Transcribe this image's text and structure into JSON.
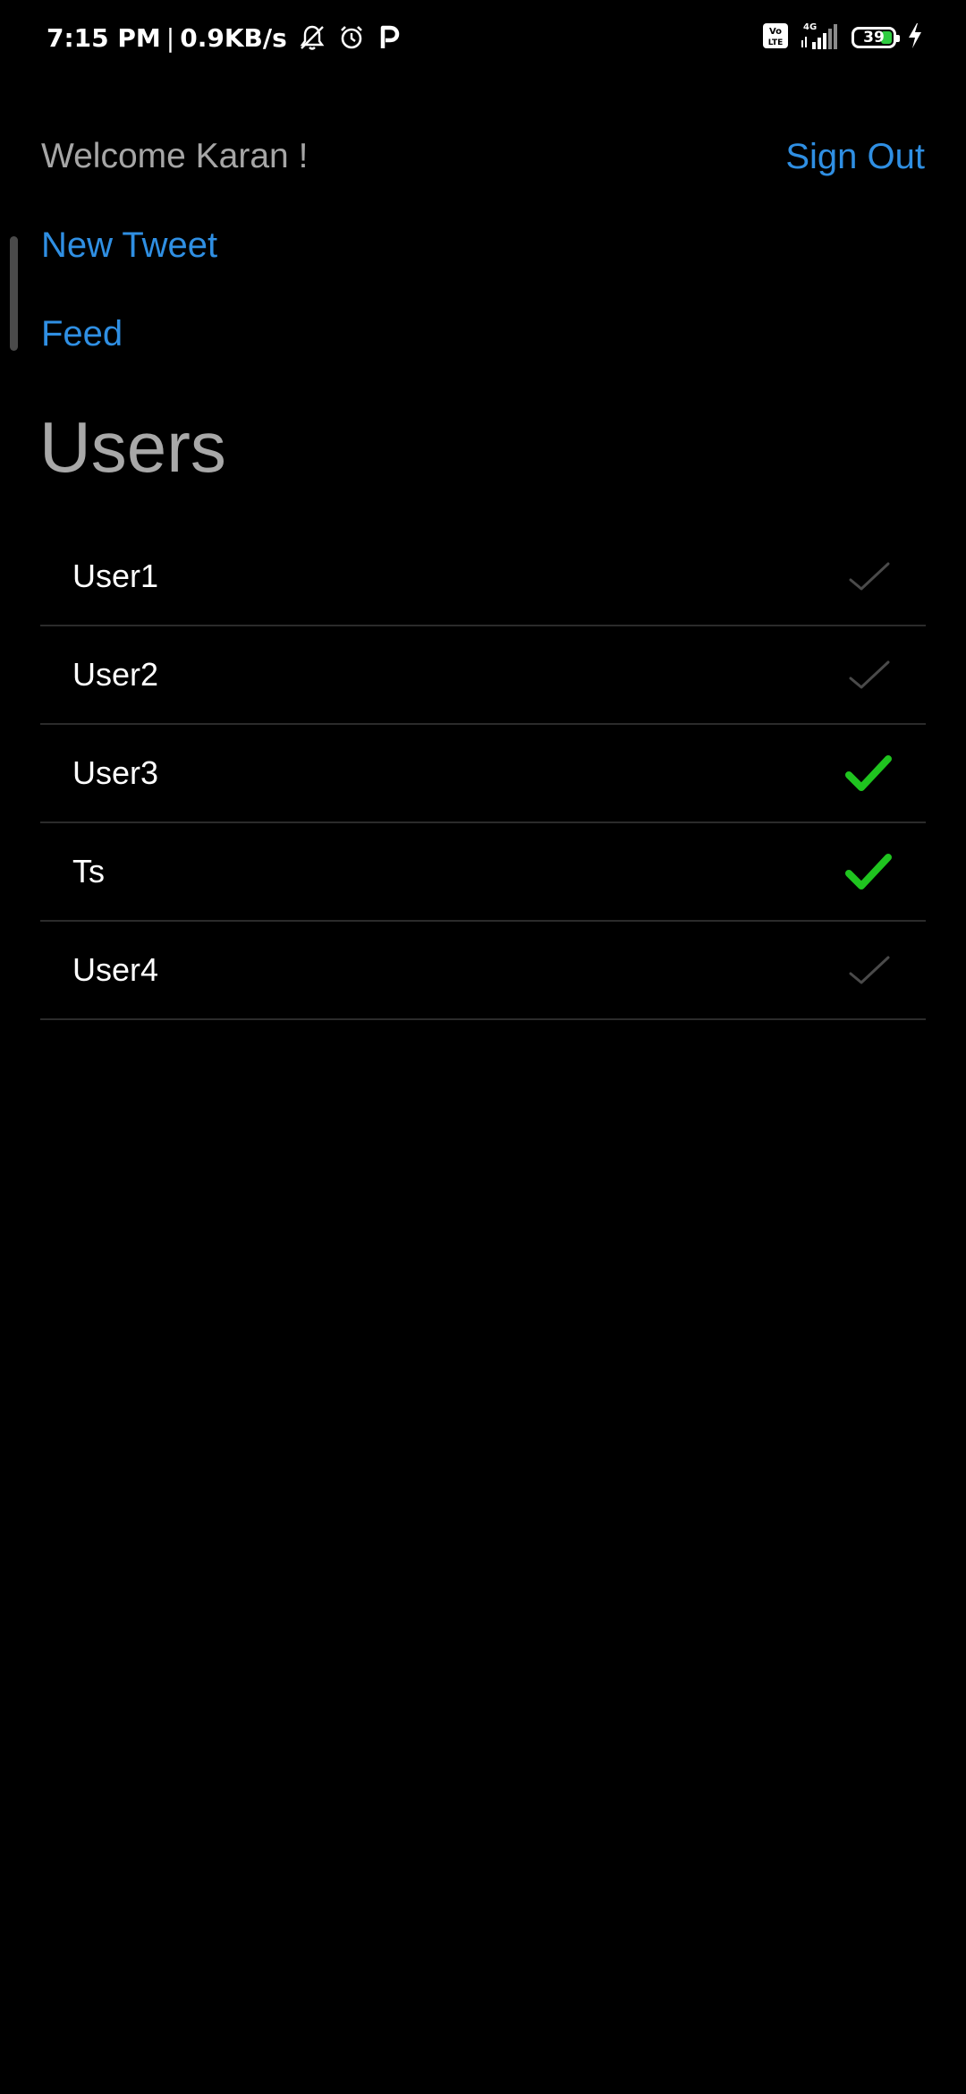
{
  "status_bar": {
    "time": "7:15 PM",
    "separator": "|",
    "net_speed": "0.9KB/s",
    "volte_label": "Vo LTE",
    "network": "4G",
    "battery_level": "39",
    "icons": [
      "bell-off-icon",
      "alarm-icon",
      "parking-icon",
      "volte-icon",
      "signal-icon",
      "battery-icon",
      "charging-icon"
    ]
  },
  "header": {
    "welcome": "Welcome Karan !",
    "sign_out": "Sign Out"
  },
  "nav": {
    "new_tweet": "New Tweet",
    "feed": "Feed"
  },
  "section": {
    "title": "Users"
  },
  "users": [
    {
      "name": "User1",
      "checked": false
    },
    {
      "name": "User2",
      "checked": false
    },
    {
      "name": "User3",
      "checked": true
    },
    {
      "name": "Ts",
      "checked": true
    },
    {
      "name": "User4",
      "checked": false
    }
  ],
  "colors": {
    "background": "#000000",
    "link": "#2f8fe3",
    "muted_text": "#a6a6a6",
    "check_on": "#1fc41f",
    "check_off": "#4a4a4a",
    "divider": "#2b2b2b"
  }
}
